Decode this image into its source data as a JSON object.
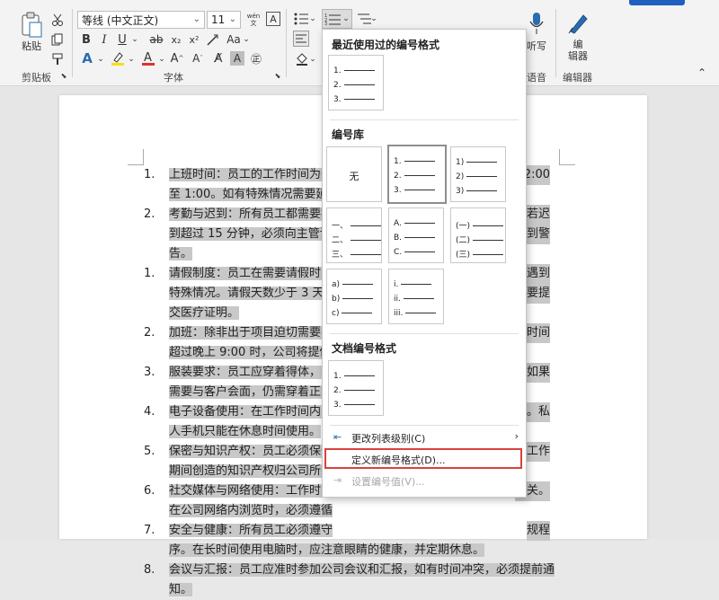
{
  "ribbon": {
    "font_name": "等线 (中文正文)",
    "font_size": "11",
    "paste_label": "粘贴",
    "clipboard_label": "剪贴板",
    "font_group_label": "字体",
    "dictate_label": "听写",
    "voice_label": "语音",
    "editor_label": "编\n辑器",
    "editor_group_label": "编辑器",
    "wen_label": "wén\n文"
  },
  "document": {
    "items": [
      {
        "num": "1.",
        "lines": [
          "上班时间：员工的工作时间为每",
          "至 1:00。如有特殊情况需要延迟"
        ],
        "right": [
          "12:00",
          ""
        ]
      },
      {
        "num": "2.",
        "lines": [
          "考勤与迟到：所有员工都需要按",
          "到超过 15 分钟，必须向主管请假",
          "告。"
        ],
        "right": [
          "若迟",
          "到警",
          ""
        ]
      },
      {
        "num": "1.",
        "lines": [
          "请假制度：员工在需要请假时，",
          "特殊情况。请假天数少于 3 天时",
          "交医疗证明。"
        ],
        "right": [
          "非遇到",
          "需要提",
          ""
        ]
      },
      {
        "num": "2.",
        "lines": [
          "加班：除非出于项目迫切需要，",
          "超过晚上 9:00 时，公司将提供晚"
        ],
        "right": [
          "班时间",
          ""
        ]
      },
      {
        "num": "3.",
        "lines": [
          "服装要求：员工应穿着得体，以",
          "需要与客户会面，仍需穿着正式"
        ],
        "right": [
          "但如果",
          ""
        ]
      },
      {
        "num": "4.",
        "lines": [
          "电子设备使用：在工作时间内，",
          "人手机只能在休息时间使用。"
        ],
        "right": [
          "作。私",
          ""
        ]
      },
      {
        "num": "5.",
        "lines": [
          "保密与知识产权：员工必须保守",
          "期间创造的知识产权归公司所有"
        ],
        "right": [
          "在工作",
          ""
        ]
      },
      {
        "num": "6.",
        "lines": [
          "社交媒体与网络使用：工作时间",
          "在公司网络内浏览时，必须遵循"
        ],
        "right": [
          "相关。",
          ""
        ]
      },
      {
        "num": "7.",
        "lines": [
          "安全与健康：所有员工必须遵守",
          "序。在长时间使用电脑时，应注意眼睛的健康，并定期休息。"
        ],
        "right": [
          "规程",
          ""
        ]
      },
      {
        "num": "8.",
        "lines": [
          "会议与汇报：员工应准时参加公司会议和汇报，如有时间冲突，必须提前通知。"
        ],
        "right": [
          ""
        ]
      }
    ]
  },
  "dropdown": {
    "recent_title": "最近使用过的编号格式",
    "library_title": "编号库",
    "doc_title": "文档编号格式",
    "none_label": "无",
    "recent_tile": [
      "1.",
      "2.",
      "3."
    ],
    "tiles": [
      [
        "1.",
        "2.",
        "3."
      ],
      [
        "1)",
        "2)",
        "3)"
      ],
      [
        "一、",
        "二、",
        "三、"
      ],
      [
        "A.",
        "B.",
        "C."
      ],
      [
        "(一)",
        "(二)",
        "(三)"
      ],
      [
        "a)",
        "b)",
        "c)"
      ],
      [
        "i.",
        "ii.",
        "iii."
      ]
    ],
    "doc_tile": [
      "1.",
      "2.",
      "3."
    ],
    "change_level": "更改列表级别(C)",
    "define_new": "定义新编号格式(D)...",
    "set_value": "设置编号值(V)..."
  }
}
